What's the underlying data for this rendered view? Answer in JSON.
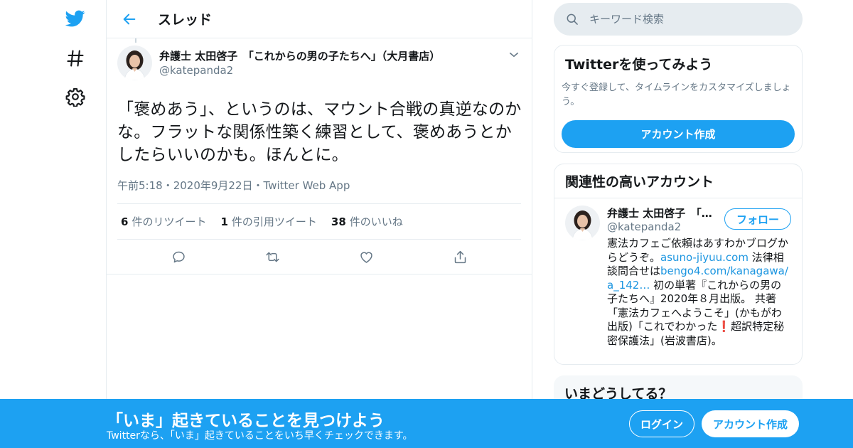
{
  "colors": {
    "accent": "#1da1f2",
    "text": "#14171a",
    "muted": "#657786",
    "border": "#e6ecf0",
    "link": "#1b95e0"
  },
  "nav": {
    "icons": [
      "twitter-bird-icon",
      "hashtag-icon",
      "gear-icon"
    ]
  },
  "header": {
    "title": "スレッド",
    "back_icon": "arrow-left-icon"
  },
  "tweet": {
    "display_name": "弁護士 太田啓子　「これからの男の子たちへ」（大月書店）",
    "handle": "@katepanda2",
    "text": "「褒めあう」、というのは、マウント合戦の真逆なのかな。フラットな関係性築く練習として、褒めあうとかしたらいいのかも。ほんとに。",
    "time": "午前5:18",
    "date": "2020年9月22日",
    "source": "Twitter Web App",
    "sep": "・",
    "retweets": {
      "count": "6",
      "label": "件のリツイート"
    },
    "quotes": {
      "count": "1",
      "label": "件の引用ツイート"
    },
    "likes": {
      "count": "38",
      "label": "件のいいね"
    }
  },
  "search": {
    "placeholder": "キーワード検索"
  },
  "try_card": {
    "title": "Twitterを使ってみよう",
    "subtitle": "今すぐ登録して、タイムラインをカスタマイズしましょう。",
    "button": "アカウント作成"
  },
  "related_card": {
    "title": "関連性の高いアカウント",
    "user_name": "弁護士 太田啓子　「…",
    "user_handle": "@katepanda2",
    "follow": "フォロー",
    "bio_1": "憲法カフェご依頼はあすわかブログからどうぞ。",
    "bio_link_1": "asuno-jiyuu.com",
    "bio_2": " 法律相談問合せは",
    "bio_link_2": "bengo4.com/kanagawa/a_142…",
    "bio_3": " 初の単著『これからの男の子たちへ』2020年８月出版。 共著「憲法カフェへようこそ」(かもがわ出版)「これでわかった",
    "bio_emoji": "❗",
    "bio_4": "超訳特定秘密保護法」(岩波書店)。"
  },
  "happening_card": {
    "title": "いまどうしてる？"
  },
  "banner": {
    "title": "「いま」起きていることを見つけよう",
    "subtitle": "Twitterなら、「いま」起きていることをいち早くチェックできます。",
    "login": "ログイン",
    "signup": "アカウント作成"
  }
}
